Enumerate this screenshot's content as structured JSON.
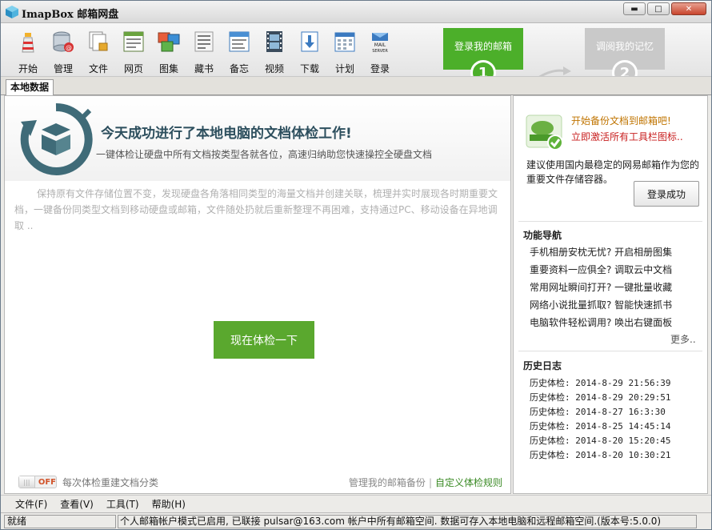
{
  "app": {
    "title": "ImapBox 邮箱网盘"
  },
  "window_buttons": {
    "minimize": "▬",
    "maximize": "□",
    "close": "✕"
  },
  "toolbar": {
    "items": [
      {
        "label": "开始",
        "icon": "lighthouse-icon"
      },
      {
        "label": "管理",
        "icon": "database-icon"
      },
      {
        "label": "文件",
        "icon": "files-icon"
      },
      {
        "label": "网页",
        "icon": "webpage-icon"
      },
      {
        "label": "图集",
        "icon": "pictures-icon"
      },
      {
        "label": "藏书",
        "icon": "book-icon"
      },
      {
        "label": "备忘",
        "icon": "memo-icon"
      },
      {
        "label": "视频",
        "icon": "video-icon"
      },
      {
        "label": "下载",
        "icon": "download-icon"
      },
      {
        "label": "计划",
        "icon": "calendar-icon"
      },
      {
        "label": "登录",
        "icon": "mail-server-icon"
      }
    ],
    "step1": {
      "label": "登录我的邮箱",
      "num": "1"
    },
    "step2": {
      "label": "调阅我的记忆",
      "num": "2"
    }
  },
  "tabs": [
    {
      "label": "本地数据"
    }
  ],
  "main": {
    "hero_title": "今天成功进行了本地电脑的文档体检工作!",
    "hero_sub": "一键体检让硬盘中所有文档按类型各就各位，高速归纳助您快速操控全硬盘文档",
    "description": "保持原有文件存储位置不变，发现硬盘各角落相同类型的海量文档并创建关联，梳理并实时展现各时期重要文档，一键备份同类型文档到移动硬盘或邮箱，文件随处扔就后重新整理不再困难，支持通过PC、移动设备在异地调取 ..",
    "check_button": "现在体检一下",
    "toggle_state": "OFF",
    "toggle_label": "每次体检重建文档分类",
    "link_backup": "管理我的邮箱备份",
    "link_separator": "|",
    "link_rules": "自定义体检规则"
  },
  "side": {
    "msg1": "开始备份文档到邮箱吧!",
    "msg2": "立即激活所有工具栏图标..",
    "para": "建议使用国内最稳定的网易邮箱作为您的重要文件存储容器。",
    "login_button": "登录成功",
    "nav_title": "功能导航",
    "nav_items": [
      "手机相册安枕无忧? 开启相册图集",
      "重要资料一应俱全? 调取云中文档",
      "常用网址瞬间打开? 一键批量收藏",
      "网络小说批量抓取? 智能快速抓书",
      "电脑软件轻松调用? 唤出右键面板"
    ],
    "more": "更多..",
    "history_title": "历史日志",
    "history": [
      "历史体检: 2014-8-29 21:56:39",
      "历史体检: 2014-8-29 20:29:51",
      "历史体检: 2014-8-27 16:3:30",
      "历史体检: 2014-8-25 14:45:14",
      "历史体检: 2014-8-20 15:20:45",
      "历史体检: 2014-8-20 10:30:21"
    ]
  },
  "menu": [
    "文件(F)",
    "查看(V)",
    "工具(T)",
    "帮助(H)"
  ],
  "status": {
    "ready": "就绪",
    "message": "个人邮箱帐户模式已启用, 已联接 pulsar@163.com 帐户中所有邮箱空间. 数据可存入本地电脑和远程邮箱空间.(版本号:5.0.0)"
  },
  "colors": {
    "accent_green": "#5aa82e",
    "step_inactive": "#c9c9c9",
    "warning_orange": "#c07400",
    "alert_red": "#c81e1e"
  }
}
